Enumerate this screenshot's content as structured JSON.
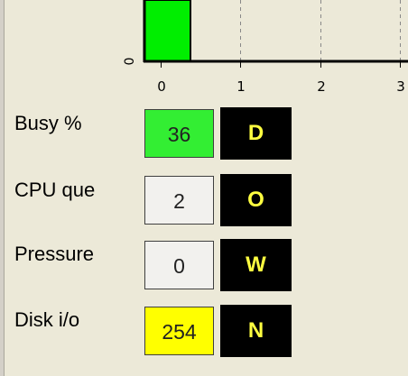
{
  "chart_data": {
    "type": "bar",
    "categories": [
      "0"
    ],
    "values": [
      0.38
    ],
    "x_ticks": [
      "0",
      "1",
      "2",
      "3"
    ],
    "xlim": [
      -0.2,
      3.1
    ],
    "y_tick_labels": [
      "0"
    ],
    "grid": "vertical dashed",
    "bar_color": "#00ee00"
  },
  "metrics": [
    {
      "label": "Busy %",
      "value": "36",
      "bg": "#33ee33",
      "status": "D"
    },
    {
      "label": "CPU que",
      "value": "2",
      "bg": "#f2f1ee",
      "status": "O"
    },
    {
      "label": "Pressure",
      "value": "0",
      "bg": "#f2f1ee",
      "status": "W"
    },
    {
      "label": "Disk i/o",
      "value": "254",
      "bg": "#ffff00",
      "status": "N"
    }
  ],
  "colors": {
    "status_bg": "#000000",
    "status_text": "#ffff40",
    "window_bg": "#ece9d8"
  }
}
